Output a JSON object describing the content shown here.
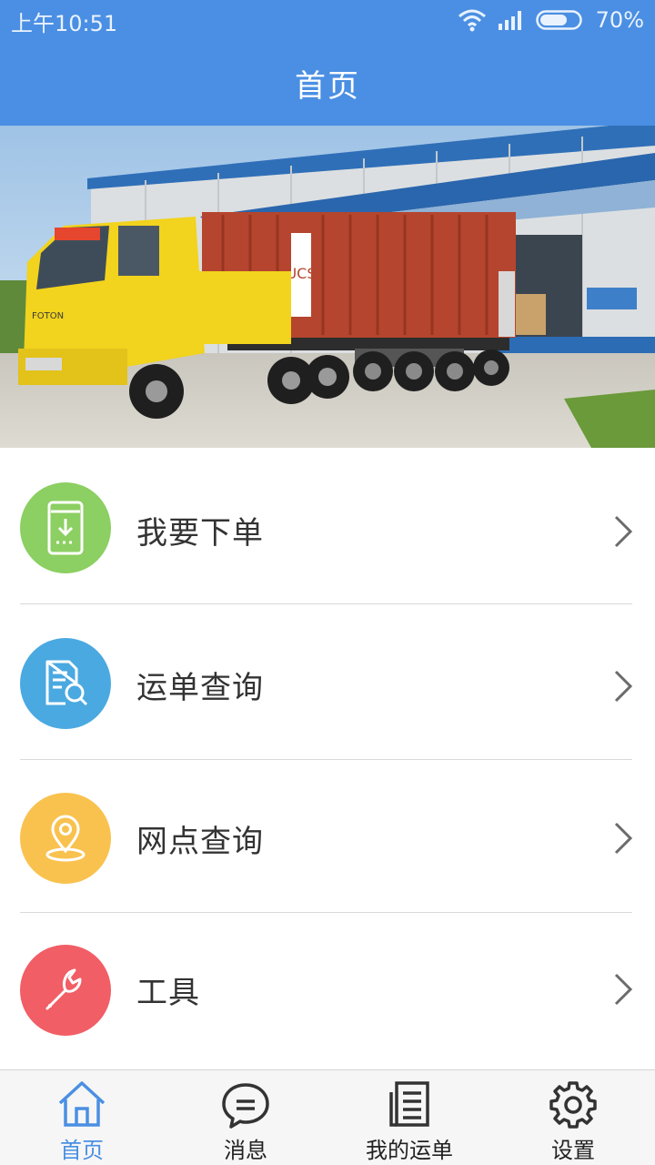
{
  "status_bar": {
    "time": "上午10:51",
    "battery_percent": "70%",
    "battery_level": 0.7,
    "icons": [
      "wifi-icon",
      "signal-icon",
      "battery-icon"
    ]
  },
  "header": {
    "title": "首页"
  },
  "banner": {
    "container_text": "UCS",
    "truck_brand": "FOTON"
  },
  "menu": {
    "items": [
      {
        "label": "我要下单",
        "icon": "order-download-icon",
        "color": "#8ccf62"
      },
      {
        "label": "运单查询",
        "icon": "document-search-icon",
        "color": "#4aa9e0"
      },
      {
        "label": "网点查询",
        "icon": "location-pin-icon",
        "color": "#f9c24f"
      },
      {
        "label": "工具",
        "icon": "wrench-icon",
        "color": "#f15e66"
      }
    ]
  },
  "tab_bar": {
    "tabs": [
      {
        "label": "首页",
        "icon": "home-icon",
        "active": true
      },
      {
        "label": "消息",
        "icon": "message-icon",
        "active": false
      },
      {
        "label": "我的运单",
        "icon": "waybill-list-icon",
        "active": false
      },
      {
        "label": "设置",
        "icon": "gear-icon",
        "active": false
      }
    ]
  },
  "colors": {
    "primary": "#4a8fe3",
    "text": "#333333",
    "divider": "#d9d9d9"
  }
}
